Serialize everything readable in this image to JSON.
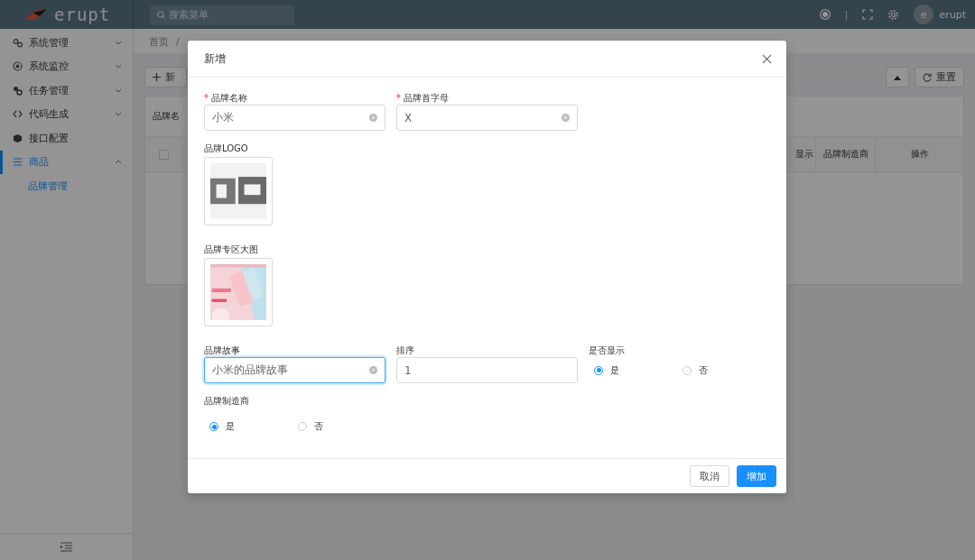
{
  "header": {
    "logo": "erupt",
    "search": {
      "placeholder": "搜索菜单"
    },
    "separator": "|",
    "user": {
      "avatar": "e",
      "name": "erupt"
    }
  },
  "sidebar": {
    "items": [
      {
        "label": "系统管理",
        "selected": false,
        "expanded": false
      },
      {
        "label": "系统监控",
        "selected": false,
        "expanded": false
      },
      {
        "label": "任务管理",
        "selected": false,
        "expanded": false
      },
      {
        "label": "代码生成",
        "selected": false,
        "expanded": false
      },
      {
        "label": "接口配置",
        "selected": false
      },
      {
        "label": "商品",
        "selected": true,
        "expanded": true,
        "children": [
          {
            "label": "品牌管理",
            "selected": true
          }
        ]
      }
    ]
  },
  "breadcrumb": [
    "首页",
    "/"
  ],
  "toolbar": {
    "add_button": "新",
    "reset_button": "重置"
  },
  "table": {
    "search_label": "品牌名",
    "header_checkbox": {
      "checked": false
    },
    "columns": [
      "显示",
      "品牌制造商",
      "操作"
    ]
  },
  "dialog": {
    "title": "新增",
    "fields": [
      {
        "kind": "text",
        "label": "品牌名称",
        "required_mark": "*",
        "value": "小米",
        "clearable": true,
        "focused": false
      },
      {
        "kind": "text",
        "label": "品牌首字母",
        "required_mark": "*",
        "value": "X",
        "clearable": true,
        "focused": false
      },
      {
        "label": "品牌LOGO"
      },
      {
        "label": "品牌专区大图"
      },
      {
        "kind": "text",
        "label": "品牌故事",
        "value": "小米的品牌故事",
        "clearable": true,
        "focused": true
      },
      {
        "kind": "text",
        "label": "排序",
        "value": "1",
        "clearable": false,
        "focused": false
      },
      {
        "kind": "radio",
        "label": "是否显示",
        "options": [
          {
            "label": "是",
            "selected": true
          },
          {
            "label": "否",
            "selected": false
          }
        ]
      },
      {
        "kind": "radio",
        "label": "品牌制造商",
        "options": [
          {
            "label": "是",
            "selected": true
          },
          {
            "label": "否",
            "selected": false
          }
        ]
      }
    ],
    "buttons": [
      {
        "label": "取消",
        "primary": false
      },
      {
        "label": "增加",
        "primary": true
      }
    ]
  }
}
